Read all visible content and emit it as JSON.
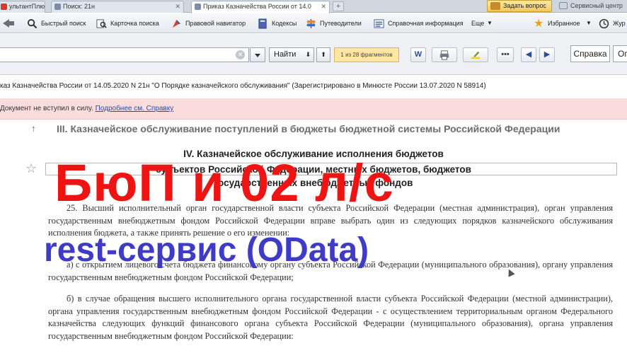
{
  "tabs": [
    {
      "label": "ультантПлюс",
      "color": "#d23a2a"
    },
    {
      "label": "Поиск: 21н",
      "color": "#7a8da8"
    },
    {
      "label": "Приказ Казначейства России от 14.0",
      "color": "#7a8da8"
    }
  ],
  "header": {
    "ask_label": "Задать вопрос",
    "service_label": "Сервисный центр"
  },
  "toolbar": {
    "items": [
      {
        "label": "Быстрый поиск",
        "icon": "search-icon"
      },
      {
        "label": "Карточка поиска",
        "icon": "search-card-icon"
      },
      {
        "label": "Правовой навигатор",
        "icon": "navigator-icon"
      },
      {
        "label": "Кодексы",
        "icon": "codes-icon"
      },
      {
        "label": "Путеводители",
        "icon": "guides-icon"
      },
      {
        "label": "Справочная информация",
        "icon": "reference-icon"
      },
      {
        "label": "Еще",
        "icon": "chevron-down-icon"
      },
      {
        "label": "Избранное",
        "icon": "star-icon"
      },
      {
        "label": "Жур",
        "icon": "history-icon"
      }
    ]
  },
  "search": {
    "find_label": "Найти",
    "fragments": "1 из 28 фрагментов",
    "help_label": "Справка",
    "help_label2": "Ог"
  },
  "document": {
    "title": "каз Казначейства России от 14.05.2020 N 21н \"О Порядке казначейского обслуживания\" (Зарегистрировано в Минюсте России 13.07.2020 N 58914)",
    "notice_text": "Документ не вступил в силу. ",
    "notice_link": "Подробнее см. Справку",
    "section3": "III. Казначейское обслуживание поступлений в бюджеты бюджетной системы Российской Федерации",
    "ch4_line1": "IV. Казначейское обслуживание исполнения бюджетов",
    "ch4_line2": "субъектов Российской Федерации, местных бюджетов, бюджетов",
    "ch4_line3": "государственных внебюджетных фондов",
    "para1": "25. Высший исполнительный орган государственной власти субъекта Российской Федерации (местная администрация), орган управления государственным внебюджетным фондом Российской Федерации вправе выбрать один из следующих порядков казначейского обслуживания исполнения бюджета, а также принять решение о его изменении:",
    "para2": "а) с открытием лицевого счета бюджета финансовому органу субъекта Российской Федерации (муниципального образования), органу управления государственным внебюджетным фондом Российской Федерации;",
    "para3": "б) в случае обращения высшего исполнительного органа государственной власти субъекта Российской Федерации (местной администрации), органа управления государственным внебюджетным фондом Российской Федерации - с осуществлением территориальным органом Федерального казначейства следующих функций финансового органа субъекта Российской Федерации (муниципального образования), органа управления государственным внебюджетным фондом Российской Федерации:"
  },
  "overlay": {
    "red_text": "БюП и 02 л/с",
    "blue_text": "rest-сервис (OData)"
  }
}
